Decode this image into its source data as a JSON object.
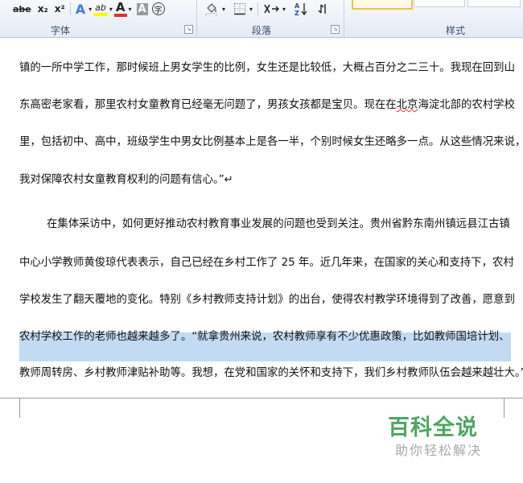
{
  "ribbon": {
    "font_buttons": {
      "strikethrough": "abe",
      "subscript": "x₂",
      "superscript": "x²",
      "text_effects": "A",
      "highlight": "ab",
      "font_color": "A",
      "char_shading": "A",
      "enclose": "字"
    },
    "para_buttons": {
      "sort": "A↓Z"
    },
    "groups": {
      "font": "字体",
      "paragraph": "段落",
      "styles": "样式"
    },
    "colors": {
      "highlight": "#ffff00",
      "font_color": "#e03030"
    }
  },
  "document": {
    "para1_lines": [
      "镇的一所中学工作，那时候班上男女学生的比例，女生还是比较低，大概占百分之二三十。我现在回到山",
      "东高密老家看，那里农村女童教育已经毫无问题了，男孩女孩都是宝贝。现在在北京海淀北部的农村学校",
      "里，包括初中、高中，班级学生中男女比例基本上是各一半，个别时候女生还略多一点。从这些情况来说，",
      "我对保障农村女童教育权利的问题有信心。”↵"
    ],
    "para1_line2_parts": {
      "before": "东高密老家看，那里农村女童教育已经毫无问题了，男孩女孩都是宝贝。现在在",
      "squiggled": "北京",
      "after": "海淀北部的农村学校"
    },
    "para2_lines": [
      "在集体采访中，如何更好推动农村教育事业发展的问题也受到关注。贵州省黔东南州镇远县江古镇",
      "中心小学教师黄俊琼代表表示，自己已经在乡村工作了 25 年。近几年来，在国家的关心和支持下，农村",
      "学校发生了翻天覆地的变化。特别《乡村教师支持计划》的出台，使得农村教学环境得到了改善，愿意到",
      "农村学校工作的老师也越来越多了。“就拿贵州来说，农村教师享有不少优惠政策，比如教师国培计划、",
      "教师周转房、乡村教师津贴补助等。我想，在党和国家的关怀和支持下，我们乡村教师队伍会越来越壮大。”"
    ]
  },
  "watermark": {
    "title": "百科全说",
    "subtitle": "助你轻松解决"
  }
}
